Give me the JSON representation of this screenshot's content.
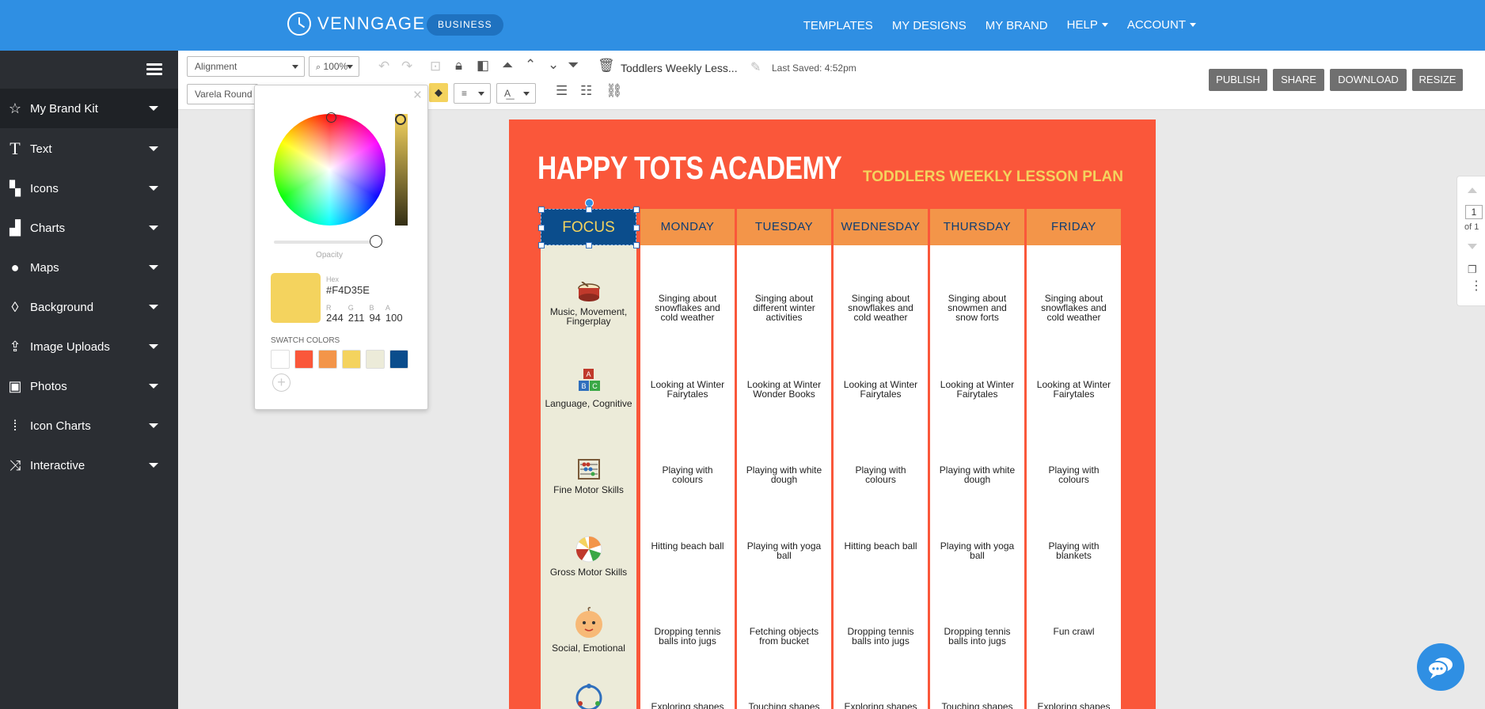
{
  "header": {
    "logo_text": "VENNGAGE",
    "badge": "BUSINESS",
    "nav": [
      "TEMPLATES",
      "MY DESIGNS",
      "MY BRAND",
      "HELP",
      "ACCOUNT"
    ]
  },
  "sidebar": {
    "items": [
      {
        "label": "My Brand Kit",
        "icon": "star-icon"
      },
      {
        "label": "Text",
        "icon": "text-icon"
      },
      {
        "label": "Icons",
        "icon": "icons-grid-icon"
      },
      {
        "label": "Charts",
        "icon": "bar-chart-icon"
      },
      {
        "label": "Maps",
        "icon": "globe-icon"
      },
      {
        "label": "Background",
        "icon": "drop-icon"
      },
      {
        "label": "Image Uploads",
        "icon": "upload-icon"
      },
      {
        "label": "Photos",
        "icon": "photo-icon"
      },
      {
        "label": "Icon Charts",
        "icon": "people-chart-icon"
      },
      {
        "label": "Interactive",
        "icon": "shuffle-icon"
      }
    ]
  },
  "toolbar": {
    "alignment": "Alignment",
    "zoom": "100%",
    "font": "Varela Round",
    "doc_title": "Toddlers Weekly Less...",
    "last_saved": "Last Saved: 4:52pm",
    "buttons": [
      "PUBLISH",
      "SHARE",
      "DOWNLOAD",
      "RESIZE"
    ]
  },
  "color_picker": {
    "opacity_label": "Opacity",
    "opacity": 1.0,
    "hex_label": "Hex",
    "hex": "#F4D35E",
    "r_label": "R",
    "r": "244",
    "g_label": "G",
    "g": "211",
    "b_label": "B",
    "b": "94",
    "a_label": "A",
    "a": "100",
    "swatch_title": "SWATCH COLORS",
    "swatches": [
      "#ffffff",
      "#fa573a",
      "#f39549",
      "#f4d35e",
      "#ecebd9",
      "#0b4d8c"
    ]
  },
  "design": {
    "title": "HAPPY TOTS ACADEMY",
    "subtitle": "TODDLERS WEEKLY LESSON PLAN",
    "focus_header": "FOCUS",
    "days": [
      "MONDAY",
      "TUESDAY",
      "WEDNESDAY",
      "THURSDAY",
      "FRIDAY"
    ],
    "focus_rows": [
      {
        "label": "Music, Movement, Fingerplay",
        "icon": "drum-icon"
      },
      {
        "label": "Language, Cognitive",
        "icon": "abc-blocks-icon"
      },
      {
        "label": "Fine Motor Skills",
        "icon": "abacus-icon"
      },
      {
        "label": "Gross Motor Skills",
        "icon": "beach-ball-icon"
      },
      {
        "label": "Social, Emotional",
        "icon": "baby-face-icon"
      },
      {
        "label": "",
        "icon": "baby-mobile-icon"
      }
    ],
    "cells": [
      [
        "Singing about snowflakes and cold weather",
        "Singing about different winter activities",
        "Singing about snowflakes and cold weather",
        "Singing about snowmen and snow forts",
        "Singing about snowflakes and cold weather"
      ],
      [
        "Looking at Winter Fairytales",
        "Looking at Winter Wonder Books",
        "Looking at Winter Fairytales",
        "Looking at Winter Fairytales",
        "Looking at Winter Fairytales"
      ],
      [
        "Playing with colours",
        "Playing with white dough",
        "Playing with colours",
        "Playing with white dough",
        "Playing with colours"
      ],
      [
        "Hitting beach ball",
        "Playing with yoga ball",
        "Hitting beach ball",
        "Playing with yoga ball",
        "Playing with blankets"
      ],
      [
        "Dropping tennis balls into jugs",
        "Fetching objects from bucket",
        "Dropping tennis balls into jugs",
        "Dropping tennis balls into jugs",
        "Fun crawl"
      ],
      [
        "Exploring shapes",
        "Touching shapes",
        "Exploring shapes",
        "Touching shapes",
        "Exploring shapes"
      ]
    ]
  },
  "pagenav": {
    "page": "1",
    "of": "of 1"
  }
}
